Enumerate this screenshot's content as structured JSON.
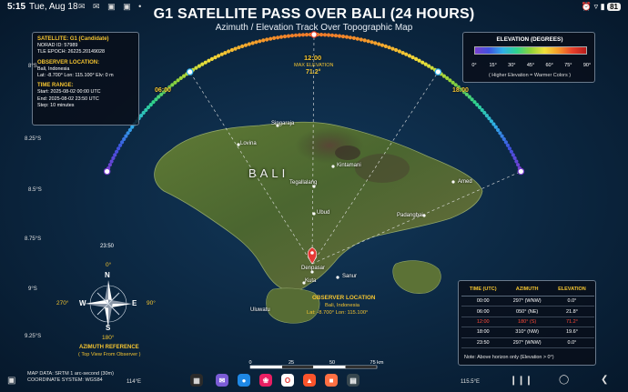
{
  "status_bar": {
    "time": "5:15",
    "date": "Tue, Aug 18",
    "icons": "✉ ✉ ▣ ▣ •",
    "right_icons": "⏰ ▿ ▮",
    "battery": "81"
  },
  "title": "G1 SATELLITE PASS OVER BALI (24 HOURS)",
  "subtitle": "Azimuth / Elevation Track Over Topographic Map",
  "info_panel": {
    "satellite": "SATELLITE: G1 (Candidate)",
    "norad": "NORAD ID: 57989",
    "tle": "TLE EPOCH: 26225.20149028",
    "observer_heading": "OBSERVER LOCATION:",
    "observer_place": "Bali, Indonesia",
    "observer_coords": "Lat: -8.700°  Lon: 115.100°  Elv: 0 m",
    "time_heading": "TIME RANGE:",
    "start": "Start:  2025-08-02 00:00 UTC",
    "end": "End:    2025-08-02 23:50 UTC",
    "step": "Step:  10 minutes"
  },
  "legend": {
    "title": "ELEVATION (DEGREES)",
    "ticks": [
      "0°",
      "15°",
      "30°",
      "45°",
      "60°",
      "75°",
      "90°"
    ],
    "note": "( Higher Elevation = Warmer Colors )"
  },
  "track": {
    "noon_label": "12:00",
    "max_label": "MAX ELEVATION",
    "max_value": "71.2°",
    "label_0600": "06:00",
    "label_1800": "18:00",
    "label_2350": "23:50",
    "max_elevation": 71.2,
    "points": 145
  },
  "lat_labels": [
    "8°S",
    "8.25°S",
    "8.5°S",
    "8.75°S",
    "9°S",
    "9.25°S"
  ],
  "lon_labels": [
    "114°E",
    "115.5°E"
  ],
  "places": {
    "singaraja": "Singaraja",
    "lovina": "Lovina",
    "kintamani": "Kintamani",
    "tegallalang": "Tegallalang",
    "ubud": "Ubud",
    "amed": "Amed",
    "padangbai": "Padangbai",
    "denpasar": "Denpasar",
    "sanur": "Sanur",
    "kuta": "Kuta",
    "uluwatu": "Uluwatu",
    "bali": "BALI"
  },
  "observer_marker": {
    "title": "OBSERVER LOCATION",
    "place": "Bali, Indonesia",
    "coords": "Lat: -8.700°  Lon: 115.100°"
  },
  "compass": {
    "n": "N",
    "s": "S",
    "e": "E",
    "w": "W",
    "deg_n": "0°",
    "deg_s": "180°",
    "deg_e": "90°",
    "deg_w": "270°",
    "ref_title": "AZIMUTH REFERENCE",
    "ref_note": "( Top View From Observer )"
  },
  "table": {
    "headers": [
      "TIME (UTC)",
      "AZIMUTH",
      "ELEVATION"
    ],
    "rows": [
      {
        "time": "00:00",
        "az": "297°  (WNW)",
        "el": "0.0°"
      },
      {
        "time": "06:00",
        "az": "050°  (NE)",
        "el": "21.8°"
      },
      {
        "time": "12:00",
        "az": "180°  (S)",
        "el": "71.2°"
      },
      {
        "time": "18:00",
        "az": "310°  (NW)",
        "el": "19.6°"
      },
      {
        "time": "23:50",
        "az": "297°  (WNW)",
        "el": "0.0°"
      }
    ],
    "note": "Note: Above horizon only (Elevation > 0°)"
  },
  "scale": {
    "labels": [
      "0",
      "25",
      "50",
      "75 km"
    ]
  },
  "footer": {
    "line1": "MAP DATA: SRTM 1 arc-second (30m)",
    "line2": "COORDINATE SYSTEM: WGS84"
  },
  "taskbar": {
    "app_labels": [
      "✉",
      "●",
      "❀",
      "O",
      "▲",
      "■",
      "▤"
    ]
  },
  "colors": {
    "accent": "#f4c430",
    "highlight": "#ff4b3a",
    "sea": "#0c2a45",
    "land": "#4e6a2c"
  }
}
